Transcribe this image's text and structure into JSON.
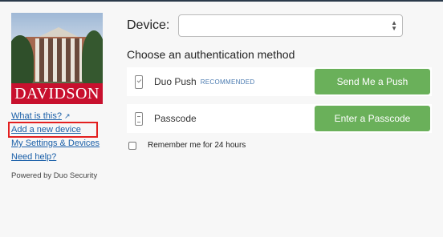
{
  "logo": {
    "text": "DAVIDSON"
  },
  "links": {
    "what_is_this": "What is this?",
    "add_device": "Add a new device",
    "my_settings": "My Settings & Devices",
    "need_help": "Need help?"
  },
  "powered_by": "Powered by Duo Security",
  "device": {
    "label": "Device:",
    "selected_value": ""
  },
  "choose_heading": "Choose an authentication method",
  "methods": [
    {
      "label": "Duo Push",
      "tag": "RECOMMENDED",
      "button": "Send Me a Push",
      "icon": "phone-push-icon"
    },
    {
      "label": "Passcode",
      "tag": "",
      "button": "Enter a Passcode",
      "icon": "passcode-icon"
    }
  ],
  "remember": {
    "label": "Remember me for 24 hours",
    "checked": false
  },
  "colors": {
    "button_green": "#6ab05a",
    "link_blue": "#1a5fa8",
    "brand_red": "#c8102e",
    "highlight_red": "#e32020"
  }
}
